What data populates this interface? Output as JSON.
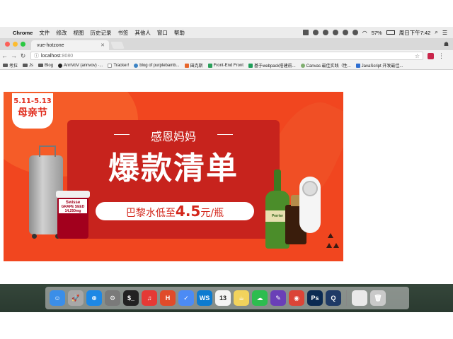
{
  "menubar": {
    "apple_icon": "apple-icon",
    "app_name": "Chrome",
    "items": [
      "文件",
      "修改",
      "视图",
      "历史记录",
      "书签",
      "其他人",
      "窗口",
      "帮助"
    ],
    "battery": "57%",
    "clock": "周日下午7:42"
  },
  "tab": {
    "title": "vue-hotzone"
  },
  "toolbar": {
    "url_host": "localhost",
    "url_port": ":8080"
  },
  "bookmarks": [
    "考拉",
    "Js",
    "Blog",
    "AnnVoV (annvov) ·...",
    "Tracker!",
    "blog of purplebamb...",
    "田克斯",
    "Front-End Front",
    "基于webpack搭建前...",
    "Canvas 最佳实践（性...",
    "JavaScript 开发最佳..."
  ],
  "banner": {
    "date_range": "5.11-5.13",
    "festival": "母亲节",
    "subtitle": "感恩妈妈",
    "headline": "爆款清单",
    "price_prefix": "巴黎水低至",
    "price_value": "4.5",
    "price_suffix": "元/瓶",
    "jar_brand": "Swisse",
    "jar_product": "GRAPE SEED",
    "jar_dose": "14,250mg",
    "bottle_brand": "Perrier"
  },
  "dock": {
    "apps": [
      {
        "name": "finder",
        "color": "#3b8ee8",
        "glyph": "☺"
      },
      {
        "name": "launchpad",
        "color": "#a7a7a7",
        "glyph": "🚀"
      },
      {
        "name": "safari",
        "color": "#1e88e5",
        "glyph": "⊕"
      },
      {
        "name": "system-preferences",
        "color": "#7a7a7a",
        "glyph": "⚙"
      },
      {
        "name": "terminal",
        "color": "#222222",
        "glyph": "$_"
      },
      {
        "name": "netease-music",
        "color": "#e53935",
        "glyph": "♫"
      },
      {
        "name": "h-app",
        "color": "#e04b2a",
        "glyph": "H"
      },
      {
        "name": "check-app",
        "color": "#4c8bf5",
        "glyph": "✓"
      },
      {
        "name": "webstorm",
        "color": "#0c7bd0",
        "glyph": "WS"
      },
      {
        "name": "calendar",
        "color": "#f4f4f4",
        "glyph": "13"
      },
      {
        "name": "notes",
        "color": "#f2d35c",
        "glyph": "☕"
      },
      {
        "name": "wechat",
        "color": "#2dbd4f",
        "glyph": "☁"
      },
      {
        "name": "feather-app",
        "color": "#6a3fb7",
        "glyph": "✎"
      },
      {
        "name": "chrome",
        "color": "#db4437",
        "glyph": "◉"
      },
      {
        "name": "photoshop",
        "color": "#0b2a52",
        "glyph": "Ps"
      },
      {
        "name": "quicktime",
        "color": "#1f3a66",
        "glyph": "Q"
      }
    ],
    "trailing": [
      {
        "name": "document",
        "color": "#e9e9e9",
        "glyph": ""
      },
      {
        "name": "trash",
        "color": "#c9c9c9",
        "glyph": "🗑"
      }
    ]
  }
}
